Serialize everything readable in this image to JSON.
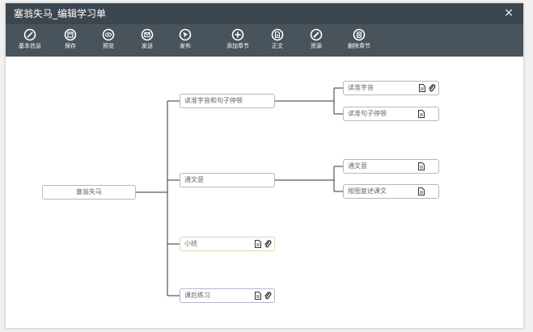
{
  "window": {
    "title": "塞翁失马_编辑学习单",
    "close_glyph": "×"
  },
  "toolbar": {
    "items": [
      {
        "label": "基本信息",
        "icon": "edit-icon"
      },
      {
        "label": "保存",
        "icon": "save-icon"
      },
      {
        "label": "预览",
        "icon": "eye-icon"
      },
      {
        "label": "发送",
        "icon": "send-icon"
      },
      {
        "label": "发布",
        "icon": "publish-icon"
      },
      {
        "label": "添加章节",
        "icon": "plus-icon"
      },
      {
        "label": "正文",
        "icon": "document-icon"
      },
      {
        "label": "资源",
        "icon": "pencil-icon"
      },
      {
        "label": "删除章节",
        "icon": "delete-icon"
      }
    ]
  },
  "mindmap": {
    "root": "塞翁失马",
    "branches": [
      {
        "label": "读准字音和句子停顿",
        "children": [
          {
            "label": "读准字音"
          },
          {
            "label": "读准句子停顿"
          }
        ]
      },
      {
        "label": "通文意",
        "children": [
          {
            "label": "通文意"
          },
          {
            "label": "按图复述课文"
          }
        ]
      },
      {
        "label": "小结",
        "children": []
      },
      {
        "label": "课后练习",
        "children": []
      }
    ]
  },
  "colors": {
    "titlebar": "#3c464e",
    "toolbar": "#49535b",
    "node_border": "#b7b3c9",
    "connector": "#333333"
  }
}
